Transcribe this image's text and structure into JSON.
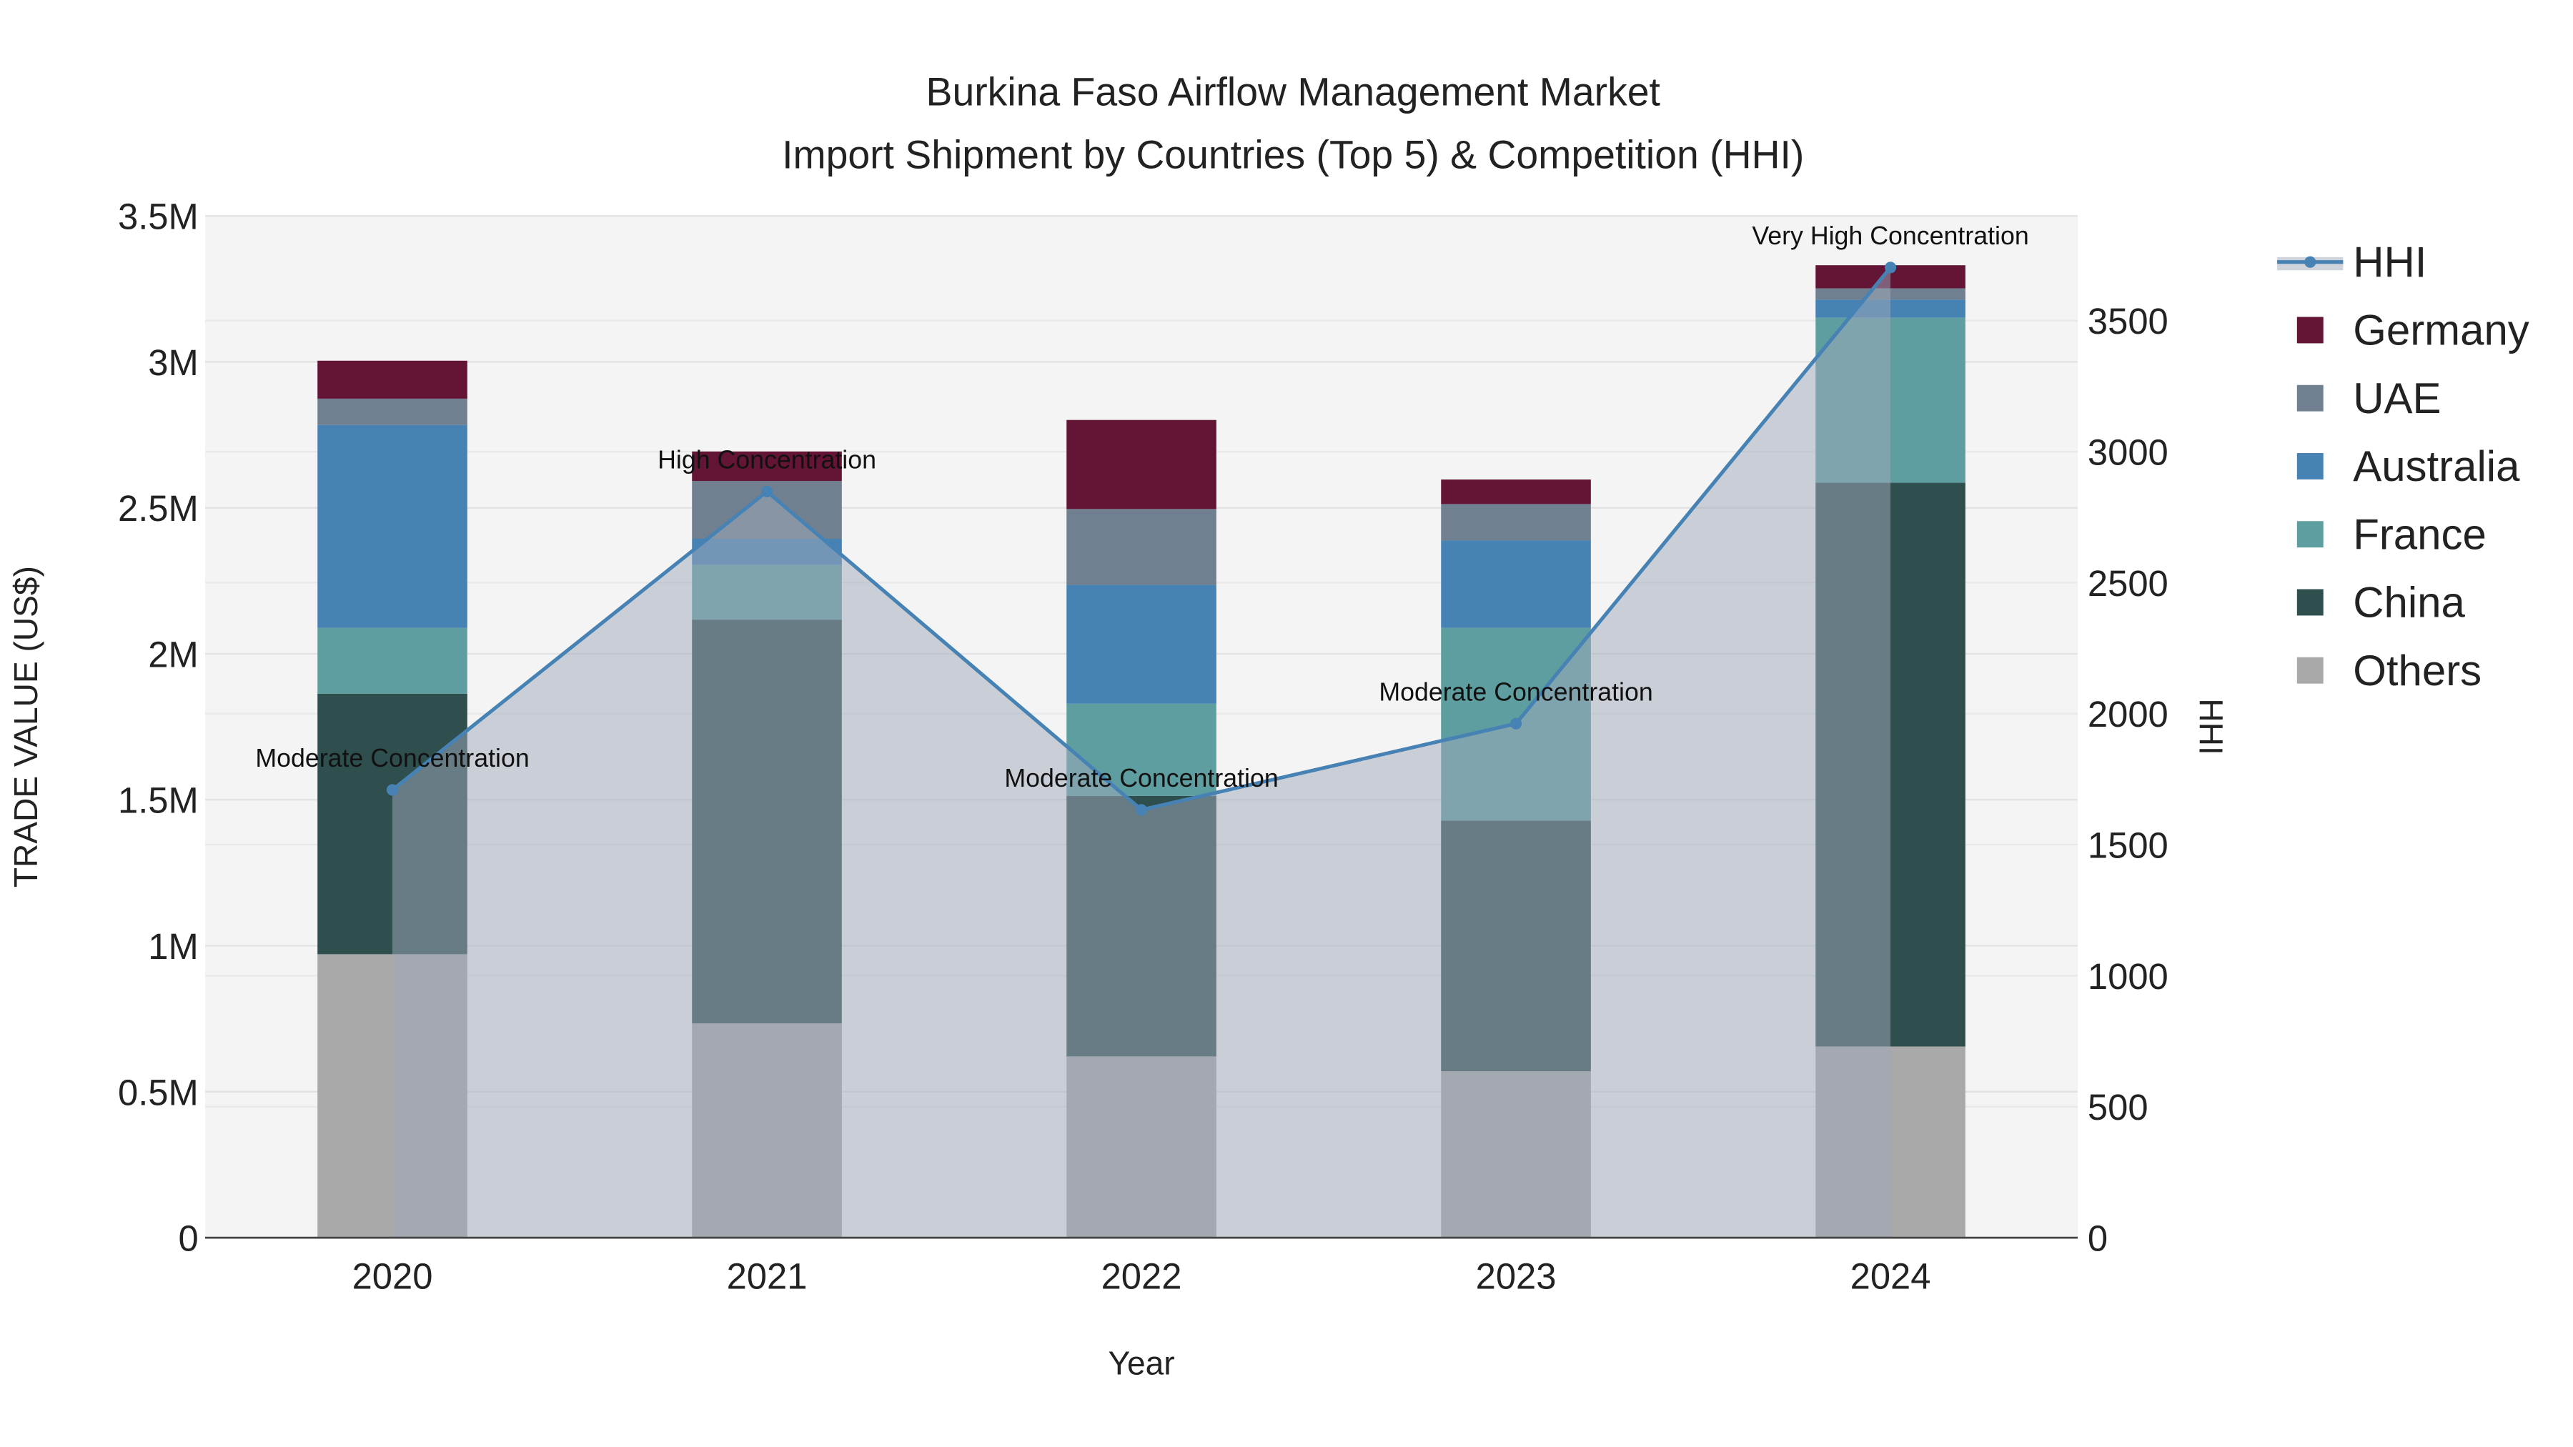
{
  "chart_data": {
    "type": "bar",
    "stacked": true,
    "title": "Burkina Faso Airflow Management Market",
    "subtitle": "Import Shipment by Countries (Top 5) & Competition (HHI)",
    "xlabel": "Year",
    "ylabel": "TRADE VALUE (US$)",
    "y2label": "HHI",
    "categories": [
      "2020",
      "2021",
      "2022",
      "2023",
      "2024"
    ],
    "ylim": [
      0,
      3500000
    ],
    "y2lim": [
      0,
      3900
    ],
    "yticks": [
      {
        "v": 0,
        "label": "0"
      },
      {
        "v": 500000,
        "label": "0.5M"
      },
      {
        "v": 1000000,
        "label": "1M"
      },
      {
        "v": 1500000,
        "label": "1.5M"
      },
      {
        "v": 2000000,
        "label": "2M"
      },
      {
        "v": 2500000,
        "label": "2.5M"
      },
      {
        "v": 3000000,
        "label": "3M"
      },
      {
        "v": 3500000,
        "label": "3.5M"
      }
    ],
    "y2ticks": [
      {
        "v": 0,
        "label": "0"
      },
      {
        "v": 500,
        "label": "500"
      },
      {
        "v": 1000,
        "label": "1000"
      },
      {
        "v": 1500,
        "label": "1500"
      },
      {
        "v": 2000,
        "label": "2000"
      },
      {
        "v": 2500,
        "label": "2500"
      },
      {
        "v": 3000,
        "label": "3000"
      },
      {
        "v": 3500,
        "label": "3500"
      }
    ],
    "series": [
      {
        "name": "Others",
        "color": "#a9a9a9",
        "values": [
          971000,
          734000,
          621000,
          570000,
          655000
        ]
      },
      {
        "name": "China",
        "color": "#2f4f4f",
        "values": [
          892000,
          1383000,
          892000,
          859000,
          1931000
        ]
      },
      {
        "name": "France",
        "color": "#5f9ea0",
        "values": [
          226000,
          187000,
          316000,
          660000,
          565000
        ]
      },
      {
        "name": "Australia",
        "color": "#4682b4",
        "values": [
          695000,
          90000,
          407000,
          299000,
          62000
        ]
      },
      {
        "name": "UAE",
        "color": "#708090",
        "values": [
          90000,
          198000,
          260000,
          125000,
          39000
        ]
      },
      {
        "name": "Germany",
        "color": "#641536",
        "values": [
          130000,
          101000,
          305000,
          84000,
          79000
        ]
      }
    ],
    "hhi": {
      "name": "HHI",
      "color": "#4682b4",
      "values": [
        1709,
        2848,
        1633,
        1962,
        3703
      ],
      "annotations": [
        "Moderate Concentration",
        "High Concentration",
        "Moderate Concentration",
        "Moderate Concentration",
        "Very High Concentration"
      ]
    },
    "legend": {
      "placement": "right",
      "order": [
        "HHI",
        "Germany",
        "UAE",
        "Australia",
        "France",
        "China",
        "Others"
      ]
    },
    "grid": true
  }
}
